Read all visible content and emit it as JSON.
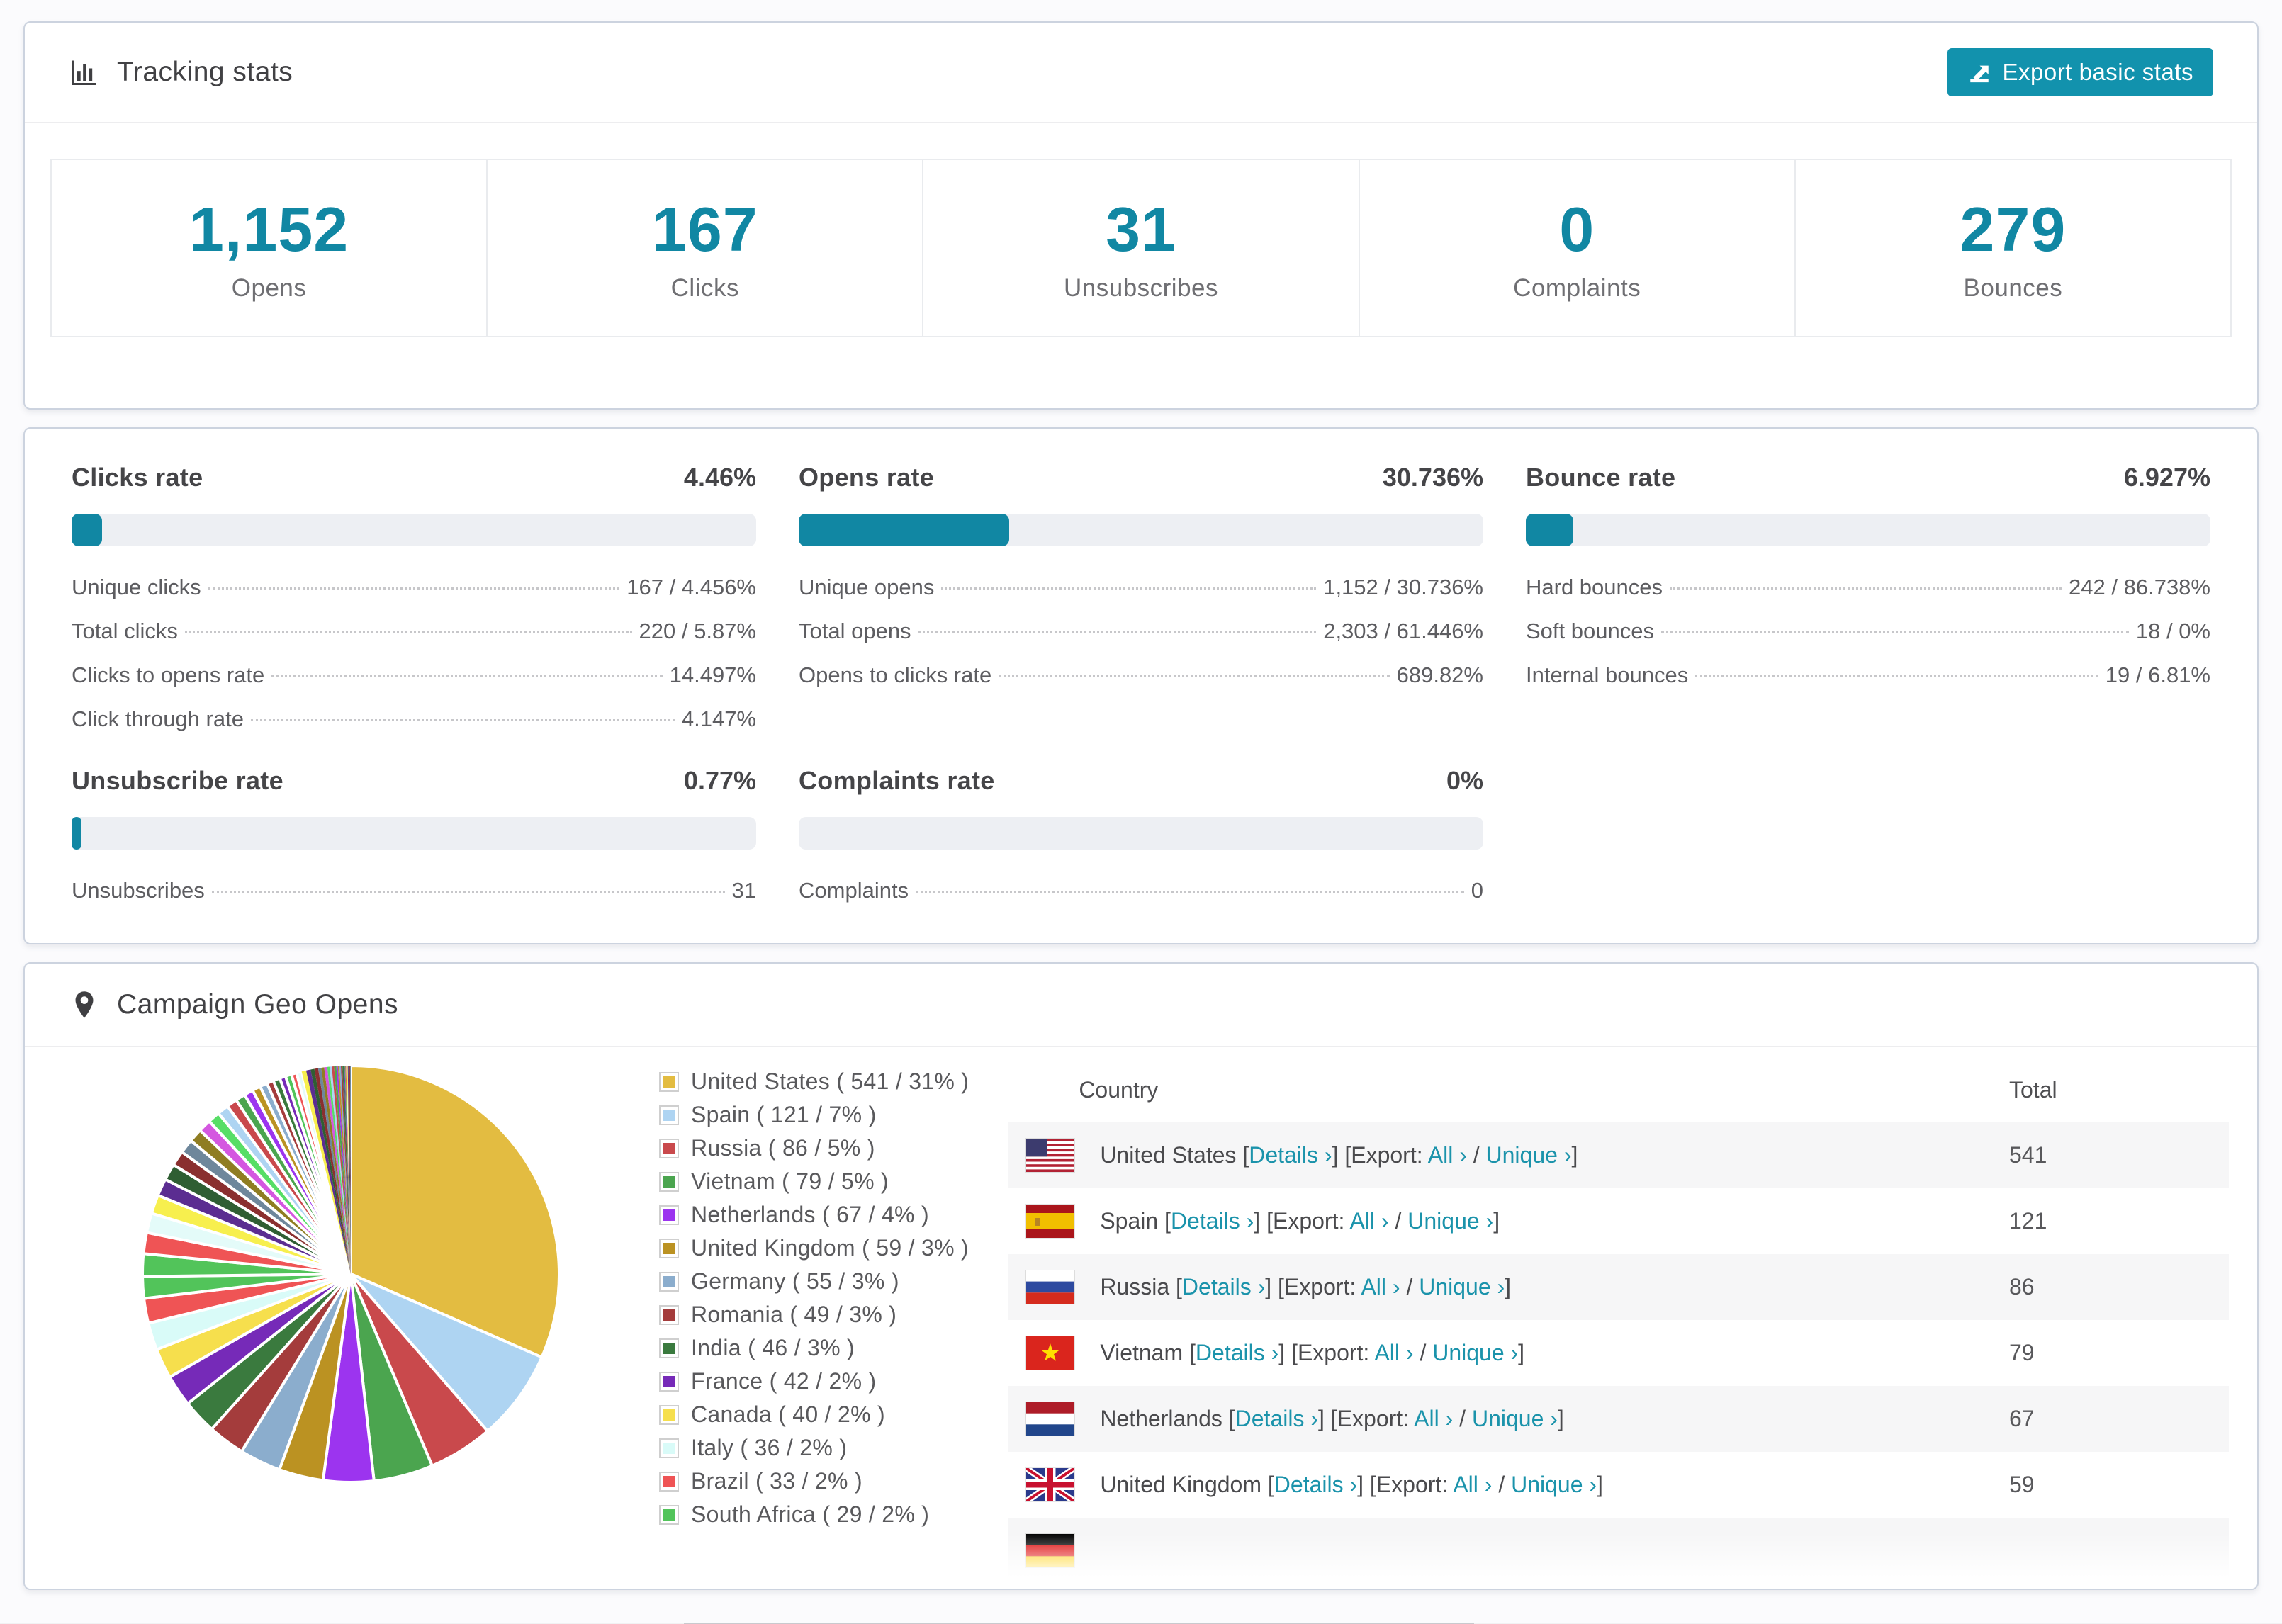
{
  "accent": "#1187a3",
  "link_color": "#1b93ab",
  "tracking": {
    "title": "Tracking stats",
    "export_label": "Export basic stats",
    "stats": [
      {
        "value": "1,152",
        "label": "Opens"
      },
      {
        "value": "167",
        "label": "Clicks"
      },
      {
        "value": "31",
        "label": "Unsubscribes"
      },
      {
        "value": "0",
        "label": "Complaints"
      },
      {
        "value": "279",
        "label": "Bounces"
      }
    ]
  },
  "rates": [
    {
      "title": "Clicks rate",
      "value": "4.46%",
      "percent": 4.46,
      "rows": [
        [
          "Unique clicks",
          "167 / 4.456%"
        ],
        [
          "Total clicks",
          "220 / 5.87%"
        ],
        [
          "Clicks to opens rate",
          "14.497%"
        ],
        [
          "Click through rate",
          "4.147%"
        ]
      ]
    },
    {
      "title": "Opens rate",
      "value": "30.736%",
      "percent": 30.736,
      "rows": [
        [
          "Unique opens",
          "1,152 / 30.736%"
        ],
        [
          "Total opens",
          "2,303 / 61.446%"
        ],
        [
          "Opens to clicks rate",
          "689.82%"
        ]
      ]
    },
    {
      "title": "Bounce rate",
      "value": "6.927%",
      "percent": 6.927,
      "rows": [
        [
          "Hard bounces",
          "242 / 86.738%"
        ],
        [
          "Soft bounces",
          "18 / 0%"
        ],
        [
          "Internal bounces",
          "19 / 6.81%"
        ]
      ]
    },
    {
      "title": "Unsubscribe rate",
      "value": "0.77%",
      "percent": 0.77,
      "rows": [
        [
          "Unsubscribes",
          "31"
        ]
      ]
    },
    {
      "title": "Complaints rate",
      "value": "0%",
      "percent": 0,
      "rows": [
        [
          "Complaints",
          "0"
        ]
      ]
    }
  ],
  "geo": {
    "title": "Campaign Geo Opens",
    "headers": {
      "country": "Country",
      "total": "Total"
    },
    "links": {
      "details": "Details",
      "export_prefix": "Export:",
      "all": "All",
      "unique": "Unique",
      "chevron": "›"
    },
    "rows": [
      {
        "country": "United States",
        "total": "541",
        "flag": "us"
      },
      {
        "country": "Spain",
        "total": "121",
        "flag": "es"
      },
      {
        "country": "Russia",
        "total": "86",
        "flag": "ru"
      },
      {
        "country": "Vietnam",
        "total": "79",
        "flag": "vn"
      },
      {
        "country": "Netherlands",
        "total": "67",
        "flag": "nl"
      },
      {
        "country": "United Kingdom",
        "total": "59",
        "flag": "gb"
      }
    ],
    "partial_row": {
      "flag": "de"
    }
  },
  "chart_data": {
    "type": "pie",
    "title": "Campaign Geo Opens",
    "legend_position": "right",
    "start_angle_deg": -90,
    "direction": "clockwise",
    "slices": [
      {
        "label": "United States",
        "value": 541,
        "pct": "31%",
        "color": "#e3bc41"
      },
      {
        "label": "Spain",
        "value": 121,
        "pct": "7%",
        "color": "#aed4f2"
      },
      {
        "label": "Russia",
        "value": 86,
        "pct": "5%",
        "color": "#c9494c"
      },
      {
        "label": "Vietnam",
        "value": 79,
        "pct": "5%",
        "color": "#4ba54f"
      },
      {
        "label": "Netherlands",
        "value": 67,
        "pct": "4%",
        "color": "#9c34ef"
      },
      {
        "label": "United Kingdom",
        "value": 59,
        "pct": "3%",
        "color": "#bb9222"
      },
      {
        "label": "Germany",
        "value": 55,
        "pct": "3%",
        "color": "#8badcd"
      },
      {
        "label": "Romania",
        "value": 49,
        "pct": "3%",
        "color": "#a43c3c"
      },
      {
        "label": "India",
        "value": 46,
        "pct": "3%",
        "color": "#3a7a3e"
      },
      {
        "label": "France",
        "value": 42,
        "pct": "2%",
        "color": "#762ab8"
      },
      {
        "label": "Canada",
        "value": 40,
        "pct": "2%",
        "color": "#f6df4d"
      },
      {
        "label": "Italy",
        "value": 36,
        "pct": "2%",
        "color": "#d9fbf8"
      },
      {
        "label": "Brazil",
        "value": 33,
        "pct": "2%",
        "color": "#ef5455"
      },
      {
        "label": "South Africa",
        "value": 29,
        "pct": "2%",
        "color": "#52c45a"
      }
    ],
    "unlabeled_tail": {
      "values": [
        30,
        28,
        26,
        25,
        23,
        22,
        20,
        19,
        18,
        17,
        16,
        15,
        14,
        13,
        12,
        11,
        10,
        9,
        9,
        8,
        8,
        7,
        7,
        6,
        6,
        5,
        5,
        4,
        4,
        4,
        3,
        3,
        3,
        3,
        2,
        2,
        2,
        2,
        2,
        1,
        1,
        1,
        1,
        1,
        1,
        1,
        1,
        1
      ],
      "palette": [
        "#52c45a",
        "#ef5455",
        "#e4fbf9",
        "#f7ef4e",
        "#5b2d91",
        "#2f5e33",
        "#8a2f2f",
        "#6e879b",
        "#8f7d22",
        "#d457e0",
        "#57de66",
        "#aed4f2",
        "#c9494c",
        "#4ba54f",
        "#9c34ef",
        "#bb9222",
        "#8badcd",
        "#a43c3c",
        "#3a7a3e",
        "#762ab8"
      ]
    }
  }
}
